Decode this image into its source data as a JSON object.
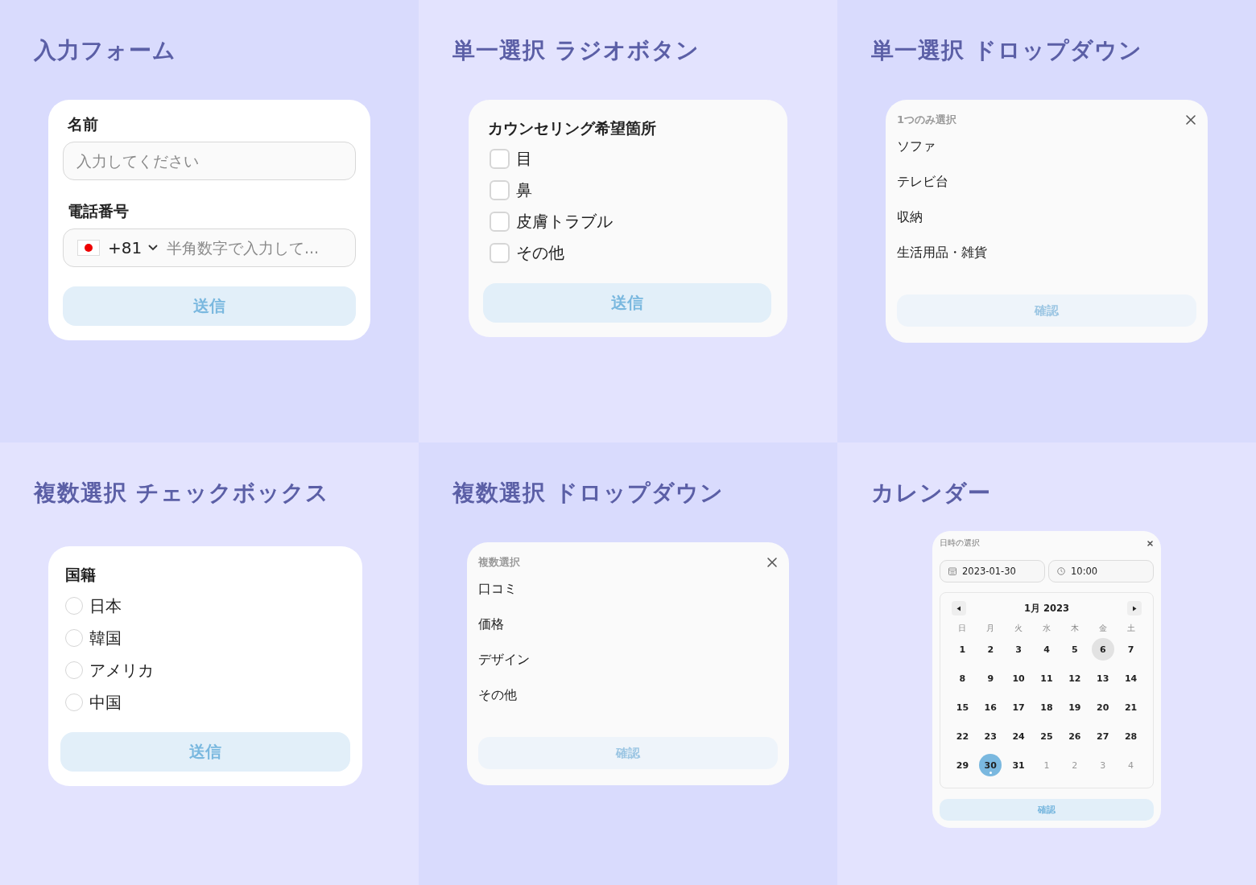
{
  "panels": [
    {
      "kind": "form",
      "title": "入力フォーム",
      "fields": [
        {
          "kind": "text",
          "label": "名前",
          "placeholder": "入力してください"
        },
        {
          "kind": "phone",
          "label": "電話番号",
          "code": "+81",
          "placeholder": "半角数字で入力して..."
        }
      ],
      "button": {
        "label": "送信",
        "disabled": false
      }
    },
    {
      "kind": "checkbox",
      "title": "単一選択 ラジオボタン",
      "question": "カウンセリング希望箇所",
      "options": [
        {
          "label": "目",
          "checked": false
        },
        {
          "label": "鼻",
          "checked": false
        },
        {
          "label": "皮膚トラブル",
          "checked": false
        },
        {
          "label": "その他",
          "checked": false
        }
      ],
      "button": {
        "label": "送信",
        "disabled": false
      }
    },
    {
      "kind": "dropdown",
      "title": "単一選択 ドロップダウン",
      "header": "1つのみ選択",
      "options": [
        {
          "label": "ソファ",
          "selected": false
        },
        {
          "label": "テレビ台",
          "selected": false
        },
        {
          "label": "収納",
          "selected": false
        },
        {
          "label": "生活用品・雑貨",
          "selected": false
        }
      ],
      "button": {
        "label": "確認",
        "disabled": true
      }
    },
    {
      "kind": "radio",
      "title": "複数選択 チェックボックス",
      "question": "国籍",
      "options": [
        {
          "label": "日本",
          "selected": false
        },
        {
          "label": "韓国",
          "selected": false
        },
        {
          "label": "アメリカ",
          "selected": false
        },
        {
          "label": "中国",
          "selected": false
        }
      ],
      "button": {
        "label": "送信",
        "disabled": false
      }
    },
    {
      "kind": "dropdown",
      "title": "複数選択 ドロップダウン",
      "header": "複数選択",
      "options": [
        {
          "label": "口コミ",
          "selected": false
        },
        {
          "label": "価格",
          "selected": false
        },
        {
          "label": "デザイン",
          "selected": false
        },
        {
          "label": "その他",
          "selected": false
        }
      ],
      "button": {
        "label": "確認",
        "disabled": true
      }
    },
    {
      "kind": "calendar",
      "title": "カレンダー",
      "header": "日時の選択",
      "date": "2023-01-30",
      "time": "10:00",
      "month": "1月 2023",
      "weekdays": [
        "日",
        "月",
        "火",
        "水",
        "木",
        "金",
        "土"
      ],
      "weeks": [
        [
          {
            "label": "1",
            "outside": false,
            "selected": false,
            "hovered": false
          },
          {
            "label": "2",
            "outside": false,
            "selected": false,
            "hovered": false
          },
          {
            "label": "3",
            "outside": false,
            "selected": false,
            "hovered": false
          },
          {
            "label": "4",
            "outside": false,
            "selected": false,
            "hovered": false
          },
          {
            "label": "5",
            "outside": false,
            "selected": false,
            "hovered": false
          },
          {
            "label": "6",
            "outside": false,
            "selected": false,
            "hovered": true
          },
          {
            "label": "7",
            "outside": false,
            "selected": false,
            "hovered": false
          }
        ],
        [
          {
            "label": "8",
            "outside": false,
            "selected": false,
            "hovered": false
          },
          {
            "label": "9",
            "outside": false,
            "selected": false,
            "hovered": false
          },
          {
            "label": "10",
            "outside": false,
            "selected": false,
            "hovered": false
          },
          {
            "label": "11",
            "outside": false,
            "selected": false,
            "hovered": false
          },
          {
            "label": "12",
            "outside": false,
            "selected": false,
            "hovered": false
          },
          {
            "label": "13",
            "outside": false,
            "selected": false,
            "hovered": false
          },
          {
            "label": "14",
            "outside": false,
            "selected": false,
            "hovered": false
          }
        ],
        [
          {
            "label": "15",
            "outside": false,
            "selected": false,
            "hovered": false
          },
          {
            "label": "16",
            "outside": false,
            "selected": false,
            "hovered": false
          },
          {
            "label": "17",
            "outside": false,
            "selected": false,
            "hovered": false
          },
          {
            "label": "18",
            "outside": false,
            "selected": false,
            "hovered": false
          },
          {
            "label": "19",
            "outside": false,
            "selected": false,
            "hovered": false
          },
          {
            "label": "20",
            "outside": false,
            "selected": false,
            "hovered": false
          },
          {
            "label": "21",
            "outside": false,
            "selected": false,
            "hovered": false
          }
        ],
        [
          {
            "label": "22",
            "outside": false,
            "selected": false,
            "hovered": false
          },
          {
            "label": "23",
            "outside": false,
            "selected": false,
            "hovered": false
          },
          {
            "label": "24",
            "outside": false,
            "selected": false,
            "hovered": false
          },
          {
            "label": "25",
            "outside": false,
            "selected": false,
            "hovered": false
          },
          {
            "label": "26",
            "outside": false,
            "selected": false,
            "hovered": false
          },
          {
            "label": "27",
            "outside": false,
            "selected": false,
            "hovered": false
          },
          {
            "label": "28",
            "outside": false,
            "selected": false,
            "hovered": false
          }
        ],
        [
          {
            "label": "29",
            "outside": false,
            "selected": false,
            "hovered": false
          },
          {
            "label": "30",
            "outside": false,
            "selected": true,
            "hovered": false
          },
          {
            "label": "31",
            "outside": false,
            "selected": false,
            "hovered": false
          },
          {
            "label": "1",
            "outside": true,
            "selected": false,
            "hovered": false
          },
          {
            "label": "2",
            "outside": true,
            "selected": false,
            "hovered": false
          },
          {
            "label": "3",
            "outside": true,
            "selected": false,
            "hovered": false
          },
          {
            "label": "4",
            "outside": true,
            "selected": false,
            "hovered": false
          }
        ]
      ],
      "button": {
        "label": "確認",
        "disabled": false
      }
    }
  ]
}
